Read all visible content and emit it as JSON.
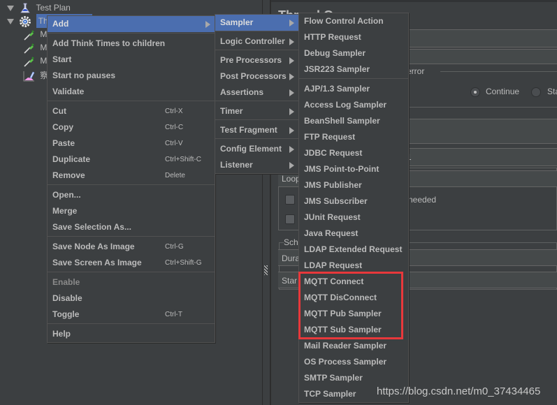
{
  "tree": {
    "items": [
      {
        "label": "Test Plan",
        "icon": "flask-icon",
        "expanded": true
      },
      {
        "label": "Thread Group",
        "visible_label": "Thre",
        "icon": "gear-icon",
        "expanded": true,
        "selected": true
      },
      {
        "label": "MQ",
        "visible_label": "MC",
        "icon": "pipette-icon"
      },
      {
        "label": "MQ",
        "visible_label": "MC",
        "icon": "pipette-icon"
      },
      {
        "label": "MQ",
        "visible_label": "MC",
        "icon": "pipette-icon"
      },
      {
        "label": "察",
        "icon": "graph-result-icon"
      }
    ]
  },
  "panel": {
    "title": "Thread Group",
    "visible_title": "Thr",
    "error_section_label": "er error",
    "radio_continue": "Continue",
    "radio_start": "Sta",
    "value_fragment": "1",
    "loop_label": "Loop",
    "needed_fragment": "needed",
    "scheduler_label": "Sch",
    "duration_label": "Dura",
    "startup_label": "Star"
  },
  "context_menu": {
    "items": [
      {
        "label": "Add",
        "submenu": true,
        "active": true
      },
      {
        "separator": true
      },
      {
        "label": "Add Think Times to children"
      },
      {
        "label": "Start"
      },
      {
        "label": "Start no pauses"
      },
      {
        "label": "Validate"
      },
      {
        "separator": true
      },
      {
        "label": "Cut",
        "shortcut": "Ctrl-X"
      },
      {
        "label": "Copy",
        "shortcut": "Ctrl-C"
      },
      {
        "label": "Paste",
        "shortcut": "Ctrl-V"
      },
      {
        "label": "Duplicate",
        "shortcut": "Ctrl+Shift-C"
      },
      {
        "label": "Remove",
        "shortcut": "Delete"
      },
      {
        "separator": true
      },
      {
        "label": "Open..."
      },
      {
        "label": "Merge"
      },
      {
        "label": "Save Selection As..."
      },
      {
        "separator": true
      },
      {
        "label": "Save Node As Image",
        "shortcut": "Ctrl-G"
      },
      {
        "label": "Save Screen As Image",
        "shortcut": "Ctrl+Shift-G"
      },
      {
        "separator": true
      },
      {
        "label": "Enable",
        "disabled": true
      },
      {
        "label": "Disable"
      },
      {
        "label": "Toggle",
        "shortcut": "Ctrl-T"
      },
      {
        "separator": true
      },
      {
        "label": "Help"
      }
    ]
  },
  "add_menu": {
    "items": [
      {
        "label": "Sampler",
        "active": true
      },
      {
        "separator": true
      },
      {
        "label": "Logic Controller"
      },
      {
        "separator": true
      },
      {
        "label": "Pre Processors"
      },
      {
        "label": "Post Processors"
      },
      {
        "label": "Assertions"
      },
      {
        "separator": true
      },
      {
        "label": "Timer"
      },
      {
        "separator": true
      },
      {
        "label": "Test Fragment"
      },
      {
        "separator": true
      },
      {
        "label": "Config Element"
      },
      {
        "label": "Listener"
      }
    ]
  },
  "sampler_menu": {
    "items": [
      {
        "label": "Flow Control Action"
      },
      {
        "label": "HTTP Request"
      },
      {
        "label": "Debug Sampler"
      },
      {
        "label": "JSR223 Sampler"
      },
      {
        "separator": true
      },
      {
        "label": "AJP/1.3 Sampler"
      },
      {
        "label": "Access Log Sampler"
      },
      {
        "label": "BeanShell Sampler"
      },
      {
        "label": "FTP Request"
      },
      {
        "label": "JDBC Request"
      },
      {
        "label": "JMS Point-to-Point"
      },
      {
        "label": "JMS Publisher"
      },
      {
        "label": "JMS Subscriber"
      },
      {
        "label": "JUnit Request"
      },
      {
        "label": "Java Request"
      },
      {
        "label": "LDAP Extended Request"
      },
      {
        "label": "LDAP Request"
      },
      {
        "label": "MQTT Connect",
        "highlighted": true
      },
      {
        "label": "MQTT DisConnect",
        "highlighted": true
      },
      {
        "label": "MQTT Pub Sampler",
        "highlighted": true
      },
      {
        "label": "MQTT Sub Sampler",
        "highlighted": true
      },
      {
        "label": "Mail Reader Sampler"
      },
      {
        "label": "OS Process Sampler"
      },
      {
        "label": "SMTP Sampler"
      },
      {
        "label": "TCP Sampler"
      }
    ]
  },
  "annotation": {
    "color": "#e8383b"
  },
  "colors": {
    "background": "#3c3f41",
    "selection": "#4b6eaf",
    "text": "#bbbbbb"
  },
  "watermark": "https://blog.csdn.net/m0_37434465"
}
